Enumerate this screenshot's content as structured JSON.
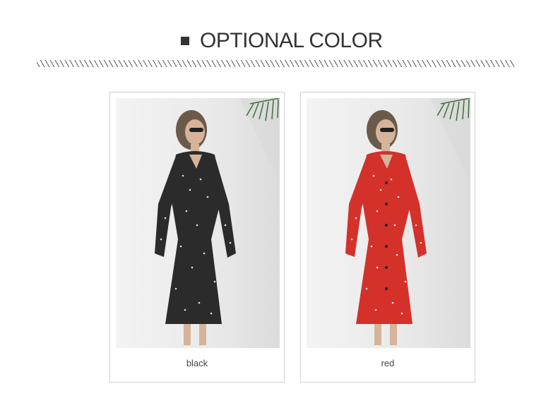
{
  "header": {
    "title": "OPTIONAL COLOR"
  },
  "products": [
    {
      "caption": "black",
      "dress_color": "#2b2b2b"
    },
    {
      "caption": "red",
      "dress_color": "#d4312b"
    }
  ],
  "colors": {
    "wall": "#ebebeb",
    "palm": "#3c6e3a",
    "skin": "#d6b39b",
    "hair": "#6b5a4a"
  }
}
